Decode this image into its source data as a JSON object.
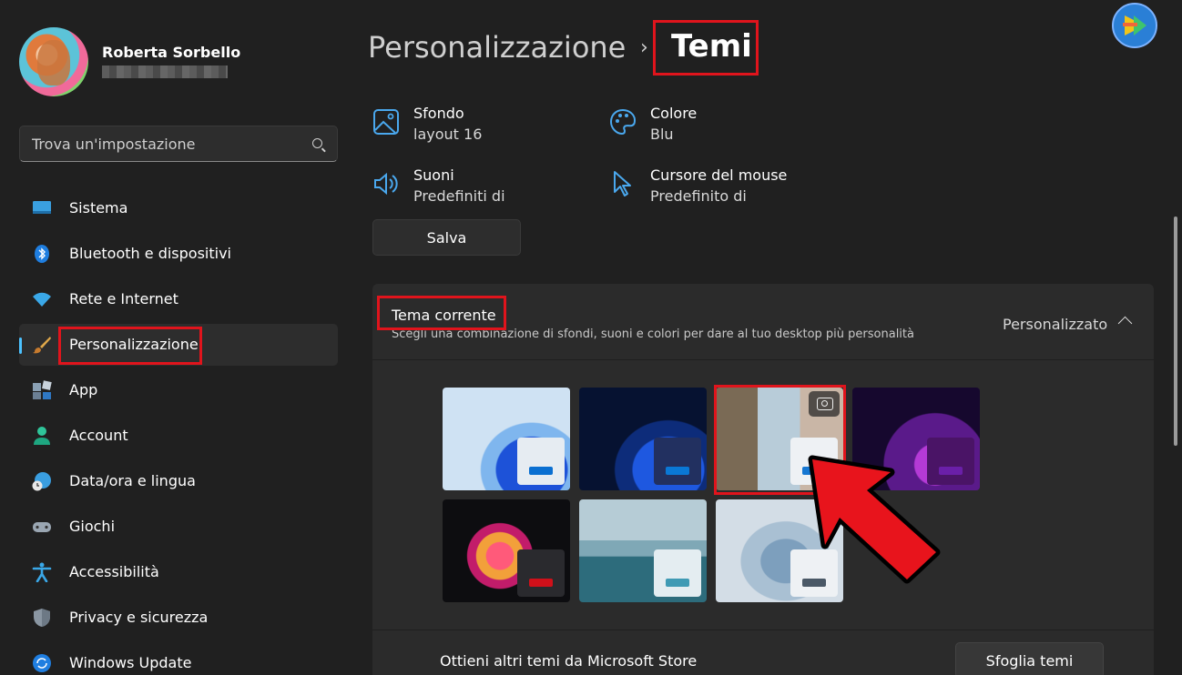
{
  "user": {
    "name": "Roberta Sorbello"
  },
  "search": {
    "placeholder": "Trova un'impostazione"
  },
  "nav": [
    {
      "label": "Sistema",
      "icon": "monitor-icon"
    },
    {
      "label": "Bluetooth e dispositivi",
      "icon": "bluetooth-icon"
    },
    {
      "label": "Rete e Internet",
      "icon": "wifi-icon"
    },
    {
      "label": "Personalizzazione",
      "icon": "paintbrush-icon",
      "active": true
    },
    {
      "label": "App",
      "icon": "apps-icon"
    },
    {
      "label": "Account",
      "icon": "person-icon"
    },
    {
      "label": "Data/ora e lingua",
      "icon": "globe-clock-icon"
    },
    {
      "label": "Giochi",
      "icon": "gamepad-icon"
    },
    {
      "label": "Accessibilità",
      "icon": "accessibility-icon"
    },
    {
      "label": "Privacy e sicurezza",
      "icon": "shield-icon"
    },
    {
      "label": "Windows Update",
      "icon": "update-icon"
    }
  ],
  "breadcrumb": {
    "parent": "Personalizzazione",
    "separator": "›",
    "current": "Temi"
  },
  "props": {
    "background": {
      "title": "Sfondo",
      "value": "layout 16",
      "icon": "image-icon"
    },
    "color": {
      "title": "Colore",
      "value": "Blu",
      "icon": "palette-icon"
    },
    "sounds": {
      "title": "Suoni",
      "value": "Predefiniti di",
      "icon": "speaker-icon"
    },
    "cursor": {
      "title": "Cursore del mouse",
      "value": "Predefinito di",
      "icon": "cursor-icon"
    }
  },
  "save_label": "Salva",
  "current_theme": {
    "title": "Tema corrente",
    "description": "Scegli una combinazione di sfondi, suoni e colori per dare al tuo desktop più personalità",
    "value": "Personalizzato"
  },
  "themes": [
    {
      "name": "windows-light-bloom",
      "accent": "#0a6fd1"
    },
    {
      "name": "windows-dark-bloom",
      "accent": "#0a78d6"
    },
    {
      "name": "custom-spring",
      "accent": "#1677d2",
      "selected": true
    },
    {
      "name": "glow",
      "accent": "#6a1fa8"
    },
    {
      "name": "captured-motion",
      "accent": "#d0101a"
    },
    {
      "name": "sunrise",
      "accent": "#3f9ab4"
    },
    {
      "name": "flow",
      "accent": "#4a5866"
    }
  ],
  "store": {
    "label": "Ottieni altri temi da Microsoft Store",
    "button": "Sfoglia temi"
  },
  "colors": {
    "accent": "#4cc2ff",
    "highlight": "#e0141c",
    "background": "#202020",
    "card": "#2b2b2b"
  }
}
